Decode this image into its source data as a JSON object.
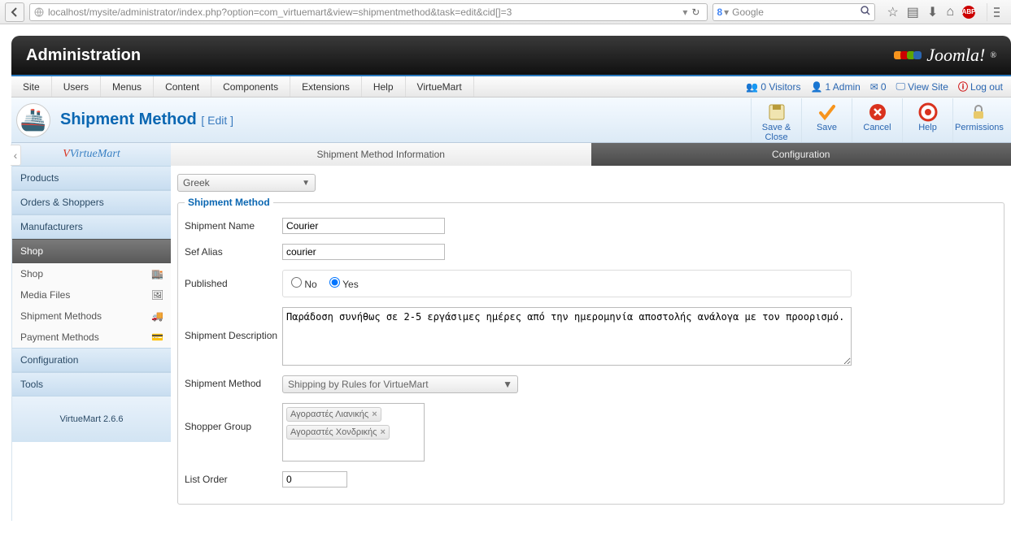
{
  "browser": {
    "url": "localhost/mysite/administrator/index.php?option=com_virtuemart&view=shipmentmethod&task=edit&cid[]=3",
    "search_engine": "Google"
  },
  "header": {
    "title": "Administration",
    "logo_text": "Joomla!"
  },
  "menu": [
    "Site",
    "Users",
    "Menus",
    "Content",
    "Components",
    "Extensions",
    "Help",
    "VirtueMart"
  ],
  "status": {
    "visitors_label": "0 Visitors",
    "admin_label": "1 Admin",
    "msgs": "0",
    "view_site": "View Site",
    "logout": "Log out"
  },
  "titlebar": {
    "title": "Shipment Method",
    "subtitle": "[ Edit ]"
  },
  "toolbar": {
    "save_close": "Save & Close",
    "save": "Save",
    "cancel": "Cancel",
    "help": "Help",
    "permissions": "Permissions"
  },
  "sidebar": {
    "brand": "VirtueMart",
    "sections": {
      "products": "Products",
      "orders": "Orders & Shoppers",
      "manufacturers": "Manufacturers",
      "shop": "Shop",
      "configuration": "Configuration",
      "tools": "Tools"
    },
    "shop_items": [
      "Shop",
      "Media Files",
      "Shipment Methods",
      "Payment Methods"
    ],
    "version": "VirtueMart 2.6.6"
  },
  "tabs": {
    "info": "Shipment Method Information",
    "config": "Configuration"
  },
  "form": {
    "lang": "Greek",
    "legend": "Shipment Method",
    "labels": {
      "name": "Shipment Name",
      "alias": "Sef Alias",
      "published": "Published",
      "desc": "Shipment Description",
      "method": "Shipment Method",
      "group": "Shopper Group",
      "order": "List Order"
    },
    "values": {
      "name": "Courier",
      "alias": "courier",
      "published_no": "No",
      "published_yes": "Yes",
      "desc": "Παράδοση συνήθως σε 2-5 εργάσιμες ημέρες από την ημερομηνία αποστολής ανάλογα με τον προορισμό.",
      "method": "Shipping by Rules for VirtueMart",
      "groups": [
        "Αγοραστές Λιανικής",
        "Αγοραστές Χονδρικής"
      ],
      "order": "0"
    }
  }
}
